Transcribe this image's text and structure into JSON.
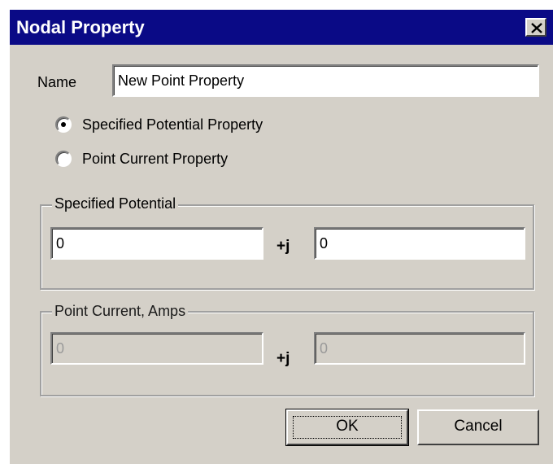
{
  "window": {
    "title": "Nodal Property",
    "close_icon": "close-icon"
  },
  "name_field": {
    "label": "Name",
    "value": "New Point Property"
  },
  "property_type": {
    "options": [
      {
        "label": "Specified Potential Property",
        "selected": true
      },
      {
        "label": "Point Current Property",
        "selected": false
      }
    ]
  },
  "specified_potential": {
    "label": "Specified Potential",
    "real": "0",
    "separator": "+j",
    "imag": "0"
  },
  "point_current": {
    "label": "Point Current, Amps",
    "real": "0",
    "separator": "+j",
    "imag": "0",
    "enabled": false
  },
  "buttons": {
    "ok": "OK",
    "cancel": "Cancel"
  },
  "colors": {
    "titlebar": "#0a0a86",
    "face": "#d4d0c8"
  }
}
